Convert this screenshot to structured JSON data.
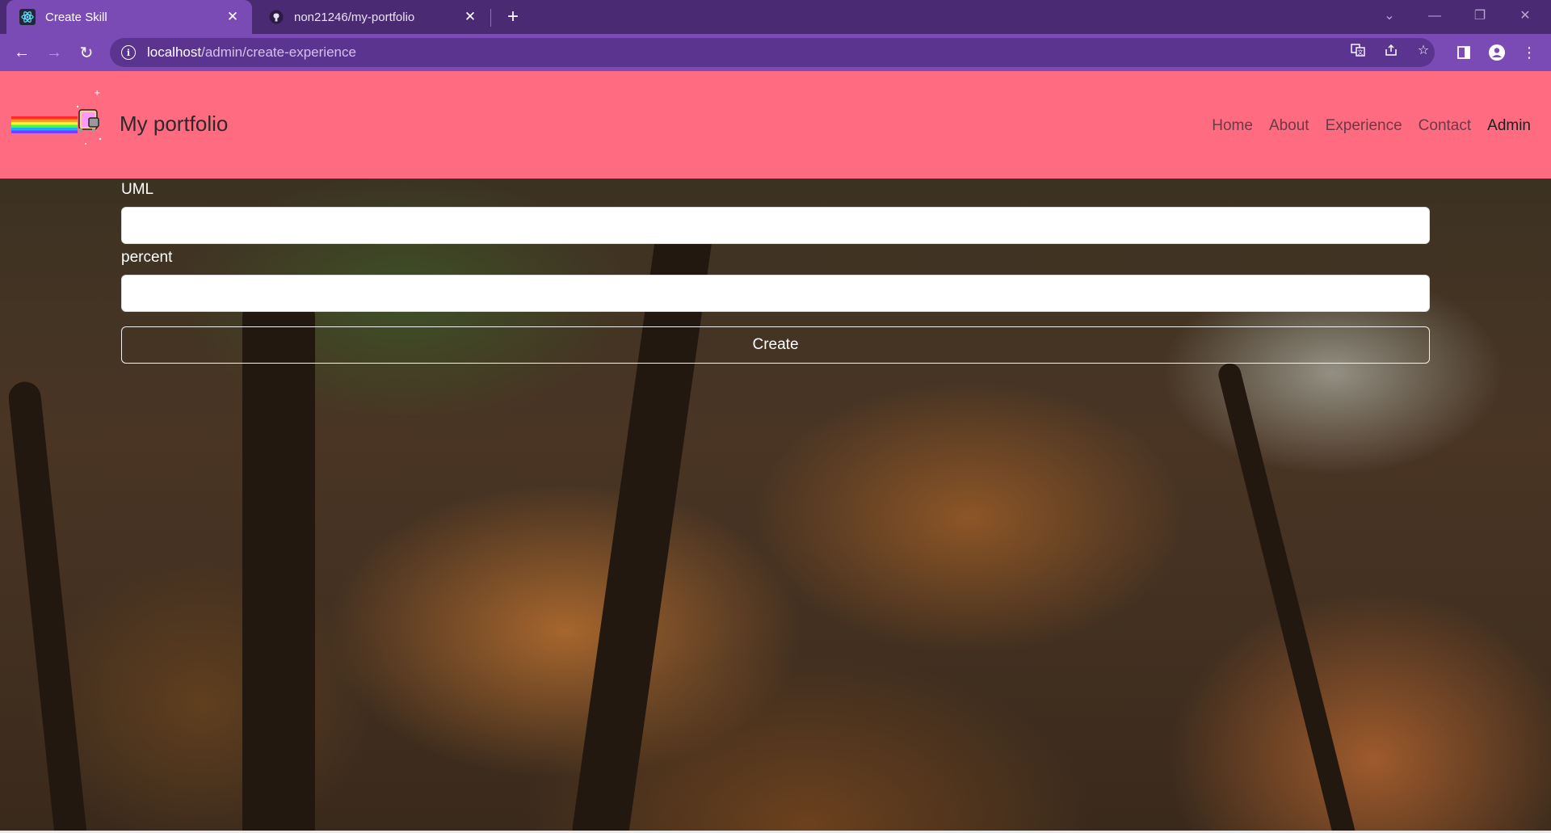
{
  "browser": {
    "tabs": [
      {
        "title": "Create Skill",
        "active": true,
        "icon": "react-icon"
      },
      {
        "title": "non21246/my-portfolio",
        "active": false,
        "icon": "github-icon"
      }
    ],
    "url_host": "localhost",
    "url_path": "/admin/create-experience"
  },
  "site": {
    "brand": "My portfolio",
    "nav": [
      "Home",
      "About",
      "Experience",
      "Contact",
      "Admin"
    ],
    "active_nav": "Admin"
  },
  "form": {
    "field1_label": "UML",
    "field1_value": "",
    "field2_label": "percent",
    "field2_value": "",
    "submit_label": "Create"
  },
  "colors": {
    "tabbar": "#4a2a72",
    "toolbar": "#7b4bb5",
    "navbar": "#ff6b81"
  }
}
